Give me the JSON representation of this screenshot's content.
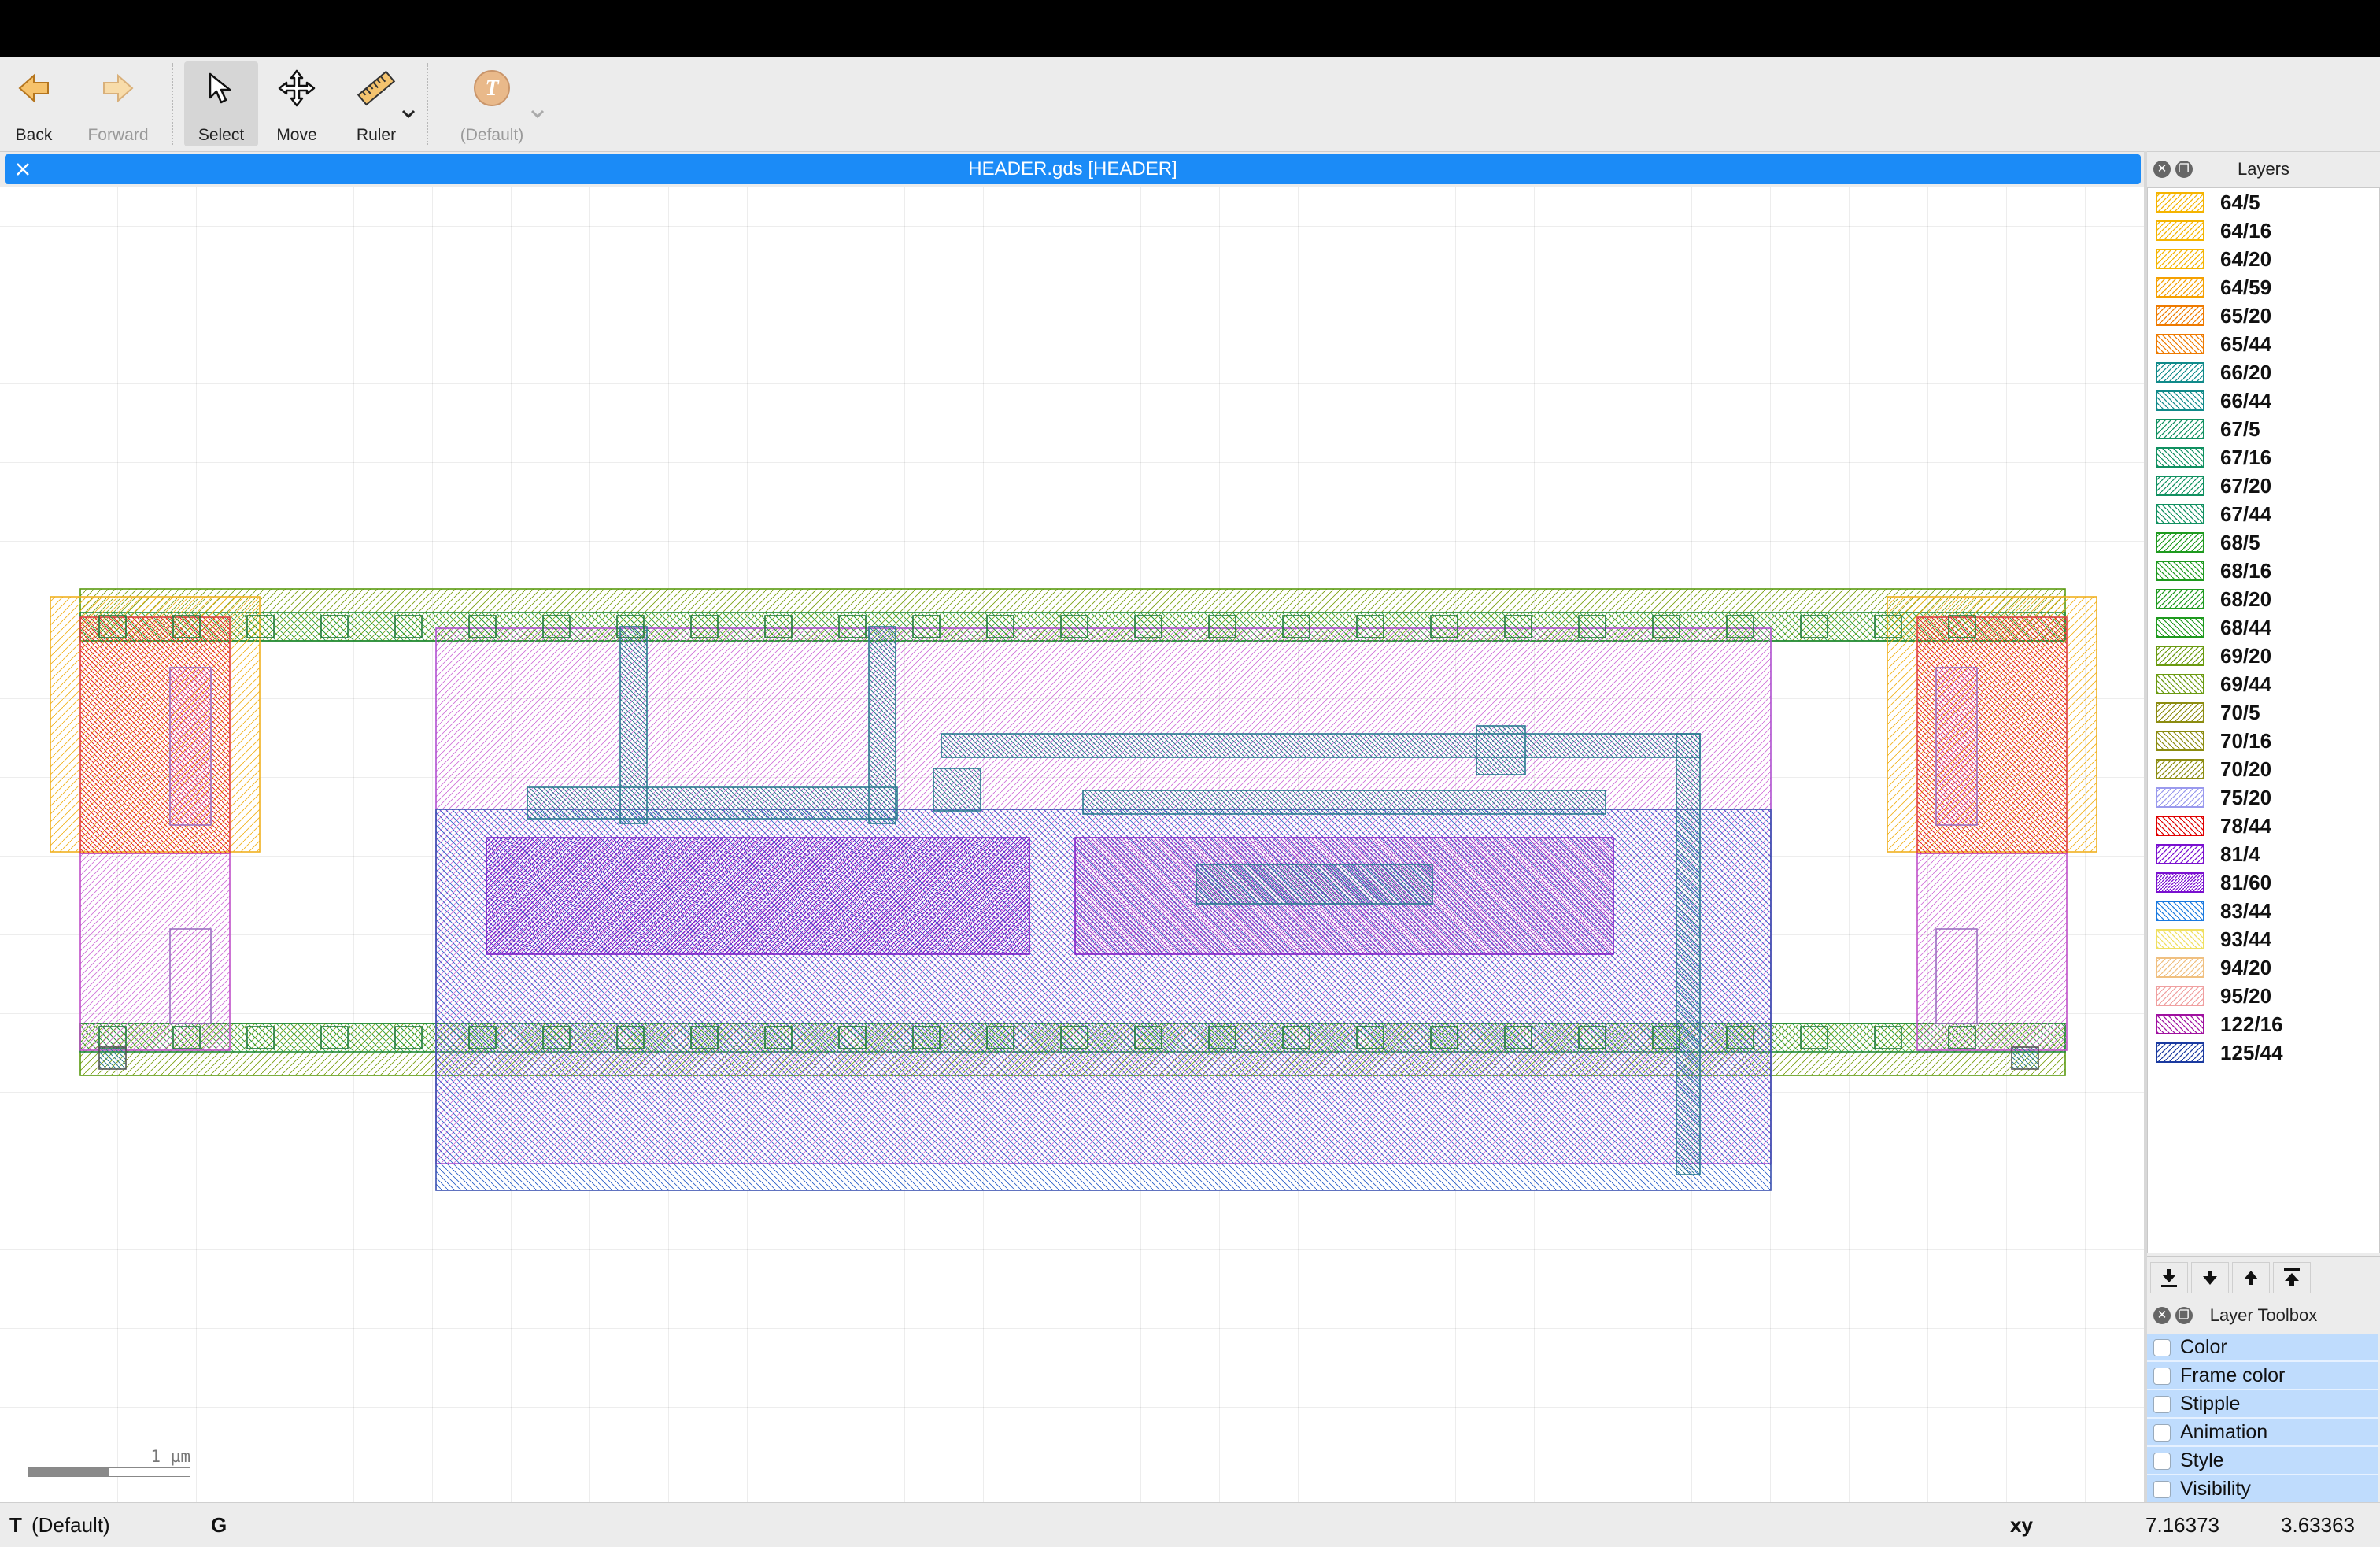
{
  "toolbar": {
    "back": "Back",
    "forward": "Forward",
    "select": "Select",
    "move": "Move",
    "ruler": "Ruler",
    "text_style": "(Default)"
  },
  "document": {
    "title": "HEADER.gds [HEADER]"
  },
  "canvas": {
    "scale_label": "1 µm"
  },
  "layers_panel": {
    "title": "Layers",
    "layers": [
      {
        "name": "64/5",
        "color": "#f5b400",
        "pattern": "fwd"
      },
      {
        "name": "64/16",
        "color": "#f5b400",
        "pattern": "fwd"
      },
      {
        "name": "64/20",
        "color": "#f5b400",
        "pattern": "fwd"
      },
      {
        "name": "64/59",
        "color": "#f5a000",
        "pattern": "fwd"
      },
      {
        "name": "65/20",
        "color": "#ee7a00",
        "pattern": "fwd"
      },
      {
        "name": "65/44",
        "color": "#ee7a00",
        "pattern": "back"
      },
      {
        "name": "66/20",
        "color": "#108a8a",
        "pattern": "fwd"
      },
      {
        "name": "66/44",
        "color": "#108a8a",
        "pattern": "back"
      },
      {
        "name": "67/5",
        "color": "#109060",
        "pattern": "fwd"
      },
      {
        "name": "67/16",
        "color": "#109060",
        "pattern": "back"
      },
      {
        "name": "67/20",
        "color": "#109060",
        "pattern": "fwd"
      },
      {
        "name": "67/44",
        "color": "#109060",
        "pattern": "back"
      },
      {
        "name": "68/5",
        "color": "#1e9a1e",
        "pattern": "fwd"
      },
      {
        "name": "68/16",
        "color": "#1e9a1e",
        "pattern": "back"
      },
      {
        "name": "68/20",
        "color": "#1e9a1e",
        "pattern": "fwd"
      },
      {
        "name": "68/44",
        "color": "#1e9a1e",
        "pattern": "back"
      },
      {
        "name": "69/20",
        "color": "#6a9a10",
        "pattern": "fwd"
      },
      {
        "name": "69/44",
        "color": "#6a9a10",
        "pattern": "back"
      },
      {
        "name": "70/5",
        "color": "#8c8c10",
        "pattern": "fwd"
      },
      {
        "name": "70/16",
        "color": "#8c8c10",
        "pattern": "back"
      },
      {
        "name": "70/20",
        "color": "#8c8c10",
        "pattern": "fwd"
      },
      {
        "name": "75/20",
        "color": "#9a9aee",
        "pattern": "fwd"
      },
      {
        "name": "78/44",
        "color": "#e00000",
        "pattern": "back"
      },
      {
        "name": "81/4",
        "color": "#7a10d0",
        "pattern": "fwd"
      },
      {
        "name": "81/60",
        "color": "#7a10d0",
        "pattern": "dense"
      },
      {
        "name": "83/44",
        "color": "#1a7ae0",
        "pattern": "back"
      },
      {
        "name": "93/44",
        "color": "#f0e060",
        "pattern": "back"
      },
      {
        "name": "94/20",
        "color": "#f0c080",
        "pattern": "fwd"
      },
      {
        "name": "95/20",
        "color": "#f0a0a0",
        "pattern": "fwd"
      },
      {
        "name": "122/16",
        "color": "#a010a0",
        "pattern": "back"
      },
      {
        "name": "125/44",
        "color": "#1a3aa0",
        "pattern": "fwd"
      }
    ]
  },
  "layer_toolbox": {
    "title": "Layer Toolbox",
    "items": [
      "Color",
      "Frame color",
      "Stipple",
      "Animation",
      "Style",
      "Visibility"
    ]
  },
  "status": {
    "text_mode": "T",
    "text_style": "(Default)",
    "grid_mode": "G",
    "coord_label": "xy",
    "x": "7.16373",
    "y": "3.63363"
  }
}
